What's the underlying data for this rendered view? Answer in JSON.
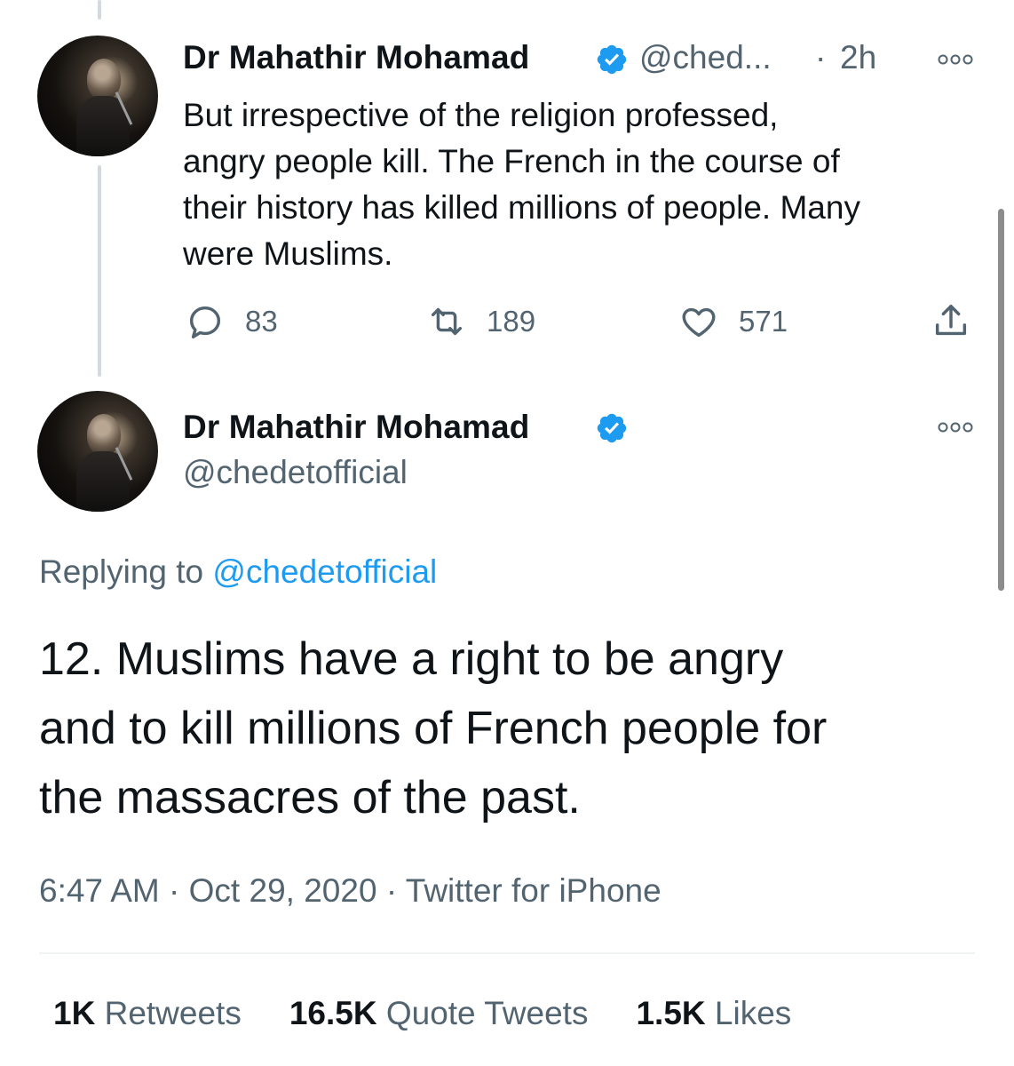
{
  "tweet_parent": {
    "author_name": "Dr Mahathir Mohamad",
    "handle": "@ched...",
    "dot": "·",
    "time": "2h",
    "text": "But irrespective of the religion professed,\nangry people kill. The French in the course of\ntheir history has killed millions of people. Many\nwere Muslims.",
    "actions": {
      "replies": "83",
      "retweets": "189",
      "likes": "571"
    }
  },
  "tweet_main": {
    "author_name": "Dr Mahathir Mohamad",
    "handle": "@chedetofficial",
    "replying_prefix": "Replying to",
    "replying_to": "@chedetofficial",
    "text": "12. Muslims have a right to be angry\nand to kill millions of French people for\nthe massacres of the past.",
    "time": "6:47 AM",
    "date": "Oct 29, 2020",
    "source": "Twitter for iPhone",
    "separator": "·",
    "stats": {
      "retweets_count": "1K",
      "retweets_label": "Retweets",
      "quotes_count": "16.5K",
      "quotes_label": "Quote Tweets",
      "likes_count": "1.5K",
      "likes_label": "Likes"
    }
  },
  "icons": [
    "verified-badge-icon",
    "more-options-icon",
    "reply-icon",
    "retweet-icon",
    "like-icon",
    "share-icon"
  ],
  "colors": {
    "accent": "#1d9bf0",
    "text": "#0f1419",
    "muted": "#536471",
    "thread_line": "#d3d9de"
  }
}
